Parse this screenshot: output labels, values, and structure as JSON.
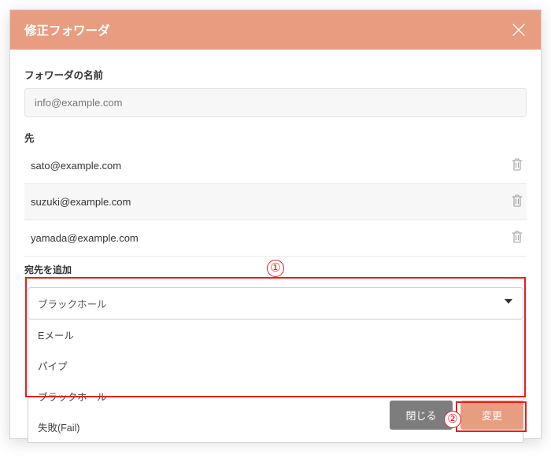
{
  "header": {
    "title": "修正フォワーダ"
  },
  "form": {
    "name_label": "フォワーダの名前",
    "name_value": "info@example.com",
    "dest_label": "先",
    "destinations": [
      "sato@example.com",
      "suzuki@example.com",
      "yamada@example.com"
    ],
    "add_label": "宛先を追加",
    "select_value": "ブラックホール",
    "options": [
      "Eメール",
      "パイプ",
      "ブラックホール",
      "失敗(Fail)"
    ]
  },
  "buttons": {
    "close": "閉じる",
    "submit": "変更"
  },
  "annotations": {
    "one": "①",
    "two": "②"
  }
}
